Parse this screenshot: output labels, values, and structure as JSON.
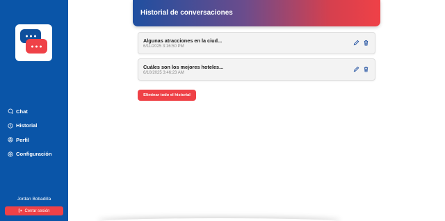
{
  "colors": {
    "sidebar": "#0a55a8",
    "accent_red": "#ef4147",
    "header_gradient_start": "#1f4fa0",
    "header_gradient_end": "#ef4147"
  },
  "sidebar": {
    "logo_icon": "chat-bubbles-logo",
    "nav": [
      {
        "label": "Chat",
        "icon": "chat-icon"
      },
      {
        "label": "Historial",
        "icon": "clock-icon"
      },
      {
        "label": "Perfil",
        "icon": "user-icon"
      },
      {
        "label": "Configuración",
        "icon": "gear-icon"
      }
    ],
    "user_name": "Jordan Bobadilla",
    "logout_label": "Cerrar sesión",
    "logout_icon": "logout-icon"
  },
  "header": {
    "title": "Historial de conversaciones"
  },
  "conversations": [
    {
      "title": "Algunas atracciones en la ciud...",
      "date": "6/11/2025 3:16:50 PM"
    },
    {
      "title": "Cuáles son los mejores hoteles...",
      "date": "6/10/2025 3:46:23 AM"
    }
  ],
  "actions": {
    "edit_icon": "pencil-icon",
    "delete_icon": "trash-icon",
    "delete_all_label": "Eliminar todo el historial"
  }
}
